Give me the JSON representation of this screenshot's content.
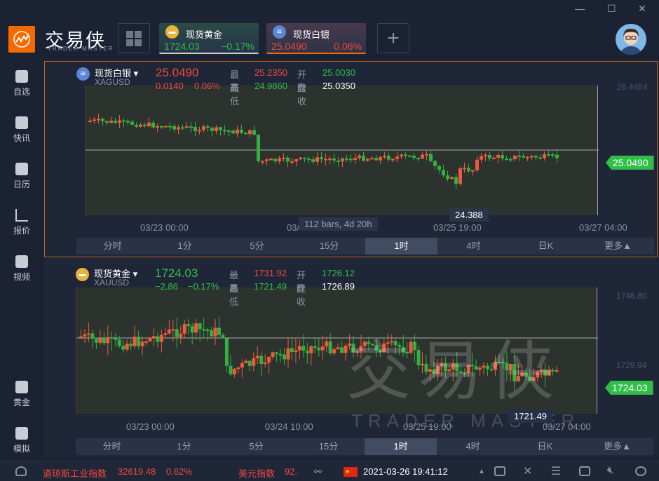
{
  "window": {
    "minimize": "—",
    "maximize": "☐",
    "close": "✕"
  },
  "brand": {
    "name": "交易侠",
    "subtitle": "TRADER MASTER"
  },
  "quote_tabs": [
    {
      "name": "现货黄金",
      "price": "1724.03",
      "change": "−0.17%"
    },
    {
      "name": "现货白银",
      "price": "25.0490",
      "change": "0.06%"
    }
  ],
  "add_label": "+",
  "sidebar": [
    {
      "label": "自选"
    },
    {
      "label": "快讯"
    },
    {
      "label": "日历"
    },
    {
      "label": "报价"
    },
    {
      "label": "视频"
    },
    {
      "label": "黄金"
    },
    {
      "label": "模拟"
    }
  ],
  "charts": [
    {
      "name": "现货白银",
      "symbol": "XAGUSD",
      "price": "25.0490",
      "change": "0.0140",
      "change_pct": "0.06%",
      "high_label": "最高",
      "high": "25.2350",
      "open_label": "开盘",
      "open": "25.0030",
      "low_label": "最低",
      "low": "24.9860",
      "prev_label": "昨收",
      "prev": "25.0350",
      "axis_top": "26.4484",
      "current_tag": "25.0490",
      "min_marker": "24.388",
      "time_labels": [
        "03/23 00:00",
        "03/2",
        "03/25 19:00",
        "03/27 04:00"
      ],
      "tooltip": "112 bars, 4d 20h"
    },
    {
      "name": "现货黄金",
      "symbol": "XAUUSD",
      "price": "1724.03",
      "change": "−2.86",
      "change_pct": "−0.17%",
      "high_label": "最高",
      "high": "1731.92",
      "open_label": "开盘",
      "open": "1726.12",
      "low_label": "最低",
      "low": "1721.49",
      "prev_label": "昨收",
      "prev": "1726.89",
      "axis_top": "1746.80",
      "axis_mid": "1729.94",
      "current_tag": "1724.03",
      "min_marker": "1721.49",
      "time_labels": [
        "03/23 00:00",
        "03/24 10:00",
        "03/25 19:00",
        "03/27 04:00"
      ]
    }
  ],
  "timeframes": [
    "分时",
    "1分",
    "5分",
    "15分",
    "1时",
    "4时",
    "日K",
    "更多▲"
  ],
  "active_timeframe": "1时",
  "watermark": {
    "name": "交易侠",
    "sub": "TRADER MASTER"
  },
  "status": {
    "dow_label": "道琼斯工业指数",
    "dow_value": "32619.48",
    "dow_change": "0.62%",
    "usd_label": "美元指数",
    "usd_value": "92.",
    "datetime": "2021-03-26 19:41:12"
  },
  "colors": {
    "up": "#f0493c",
    "down": "#2fbf46",
    "accent": "#f56a00"
  }
}
